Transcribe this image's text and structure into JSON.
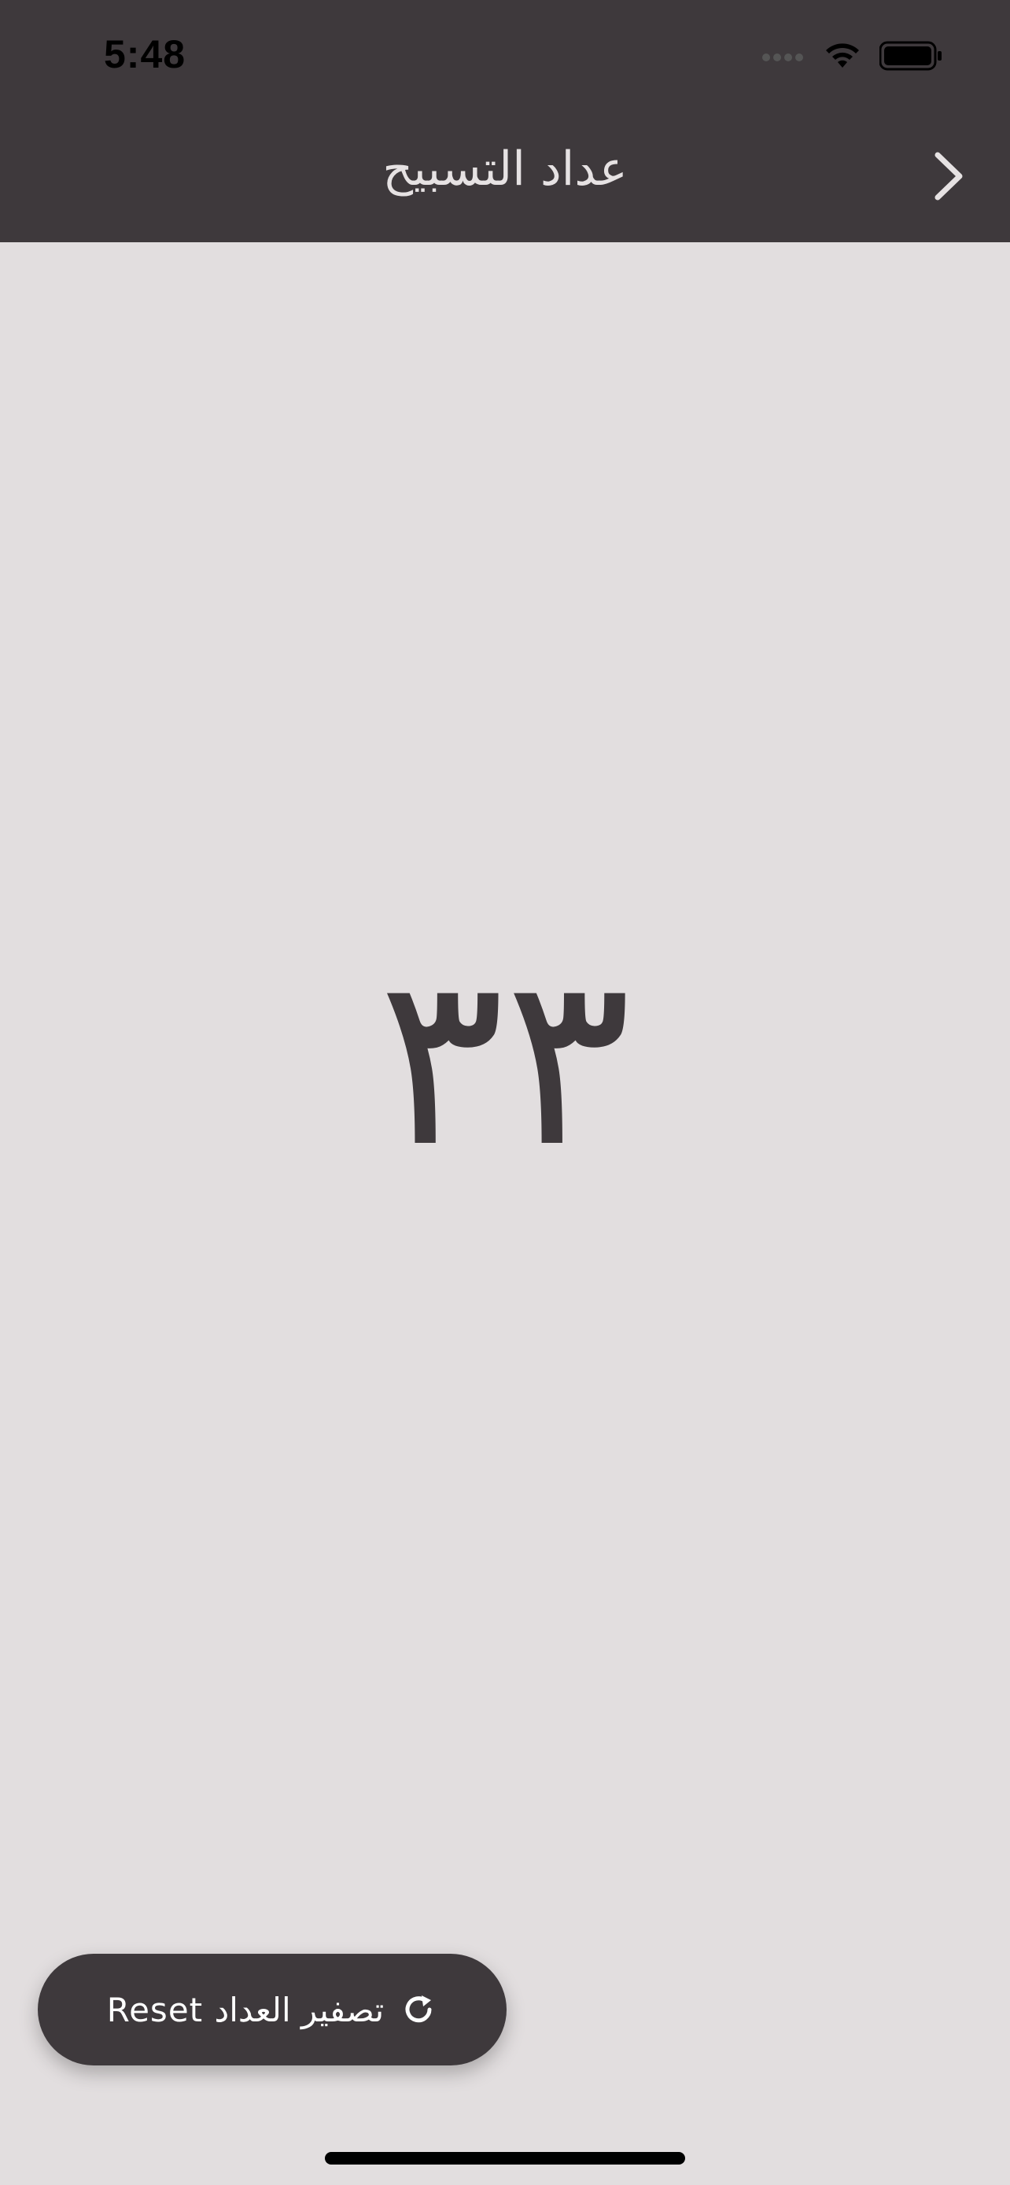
{
  "status_bar": {
    "time": "5:48",
    "icons": [
      "signal-dots-icon",
      "wifi-icon",
      "battery-icon"
    ]
  },
  "nav": {
    "title": "عداد التسبيح",
    "back_icon": "chevron-right-icon"
  },
  "counter": {
    "value": "٣٣"
  },
  "reset_button": {
    "label": "Reset تصفير العداد",
    "icon": "refresh-icon"
  },
  "colors": {
    "background": "#e2dedf",
    "header": "#3e393c",
    "text_dark": "#3e393c",
    "text_light": "#e6e2e3"
  }
}
